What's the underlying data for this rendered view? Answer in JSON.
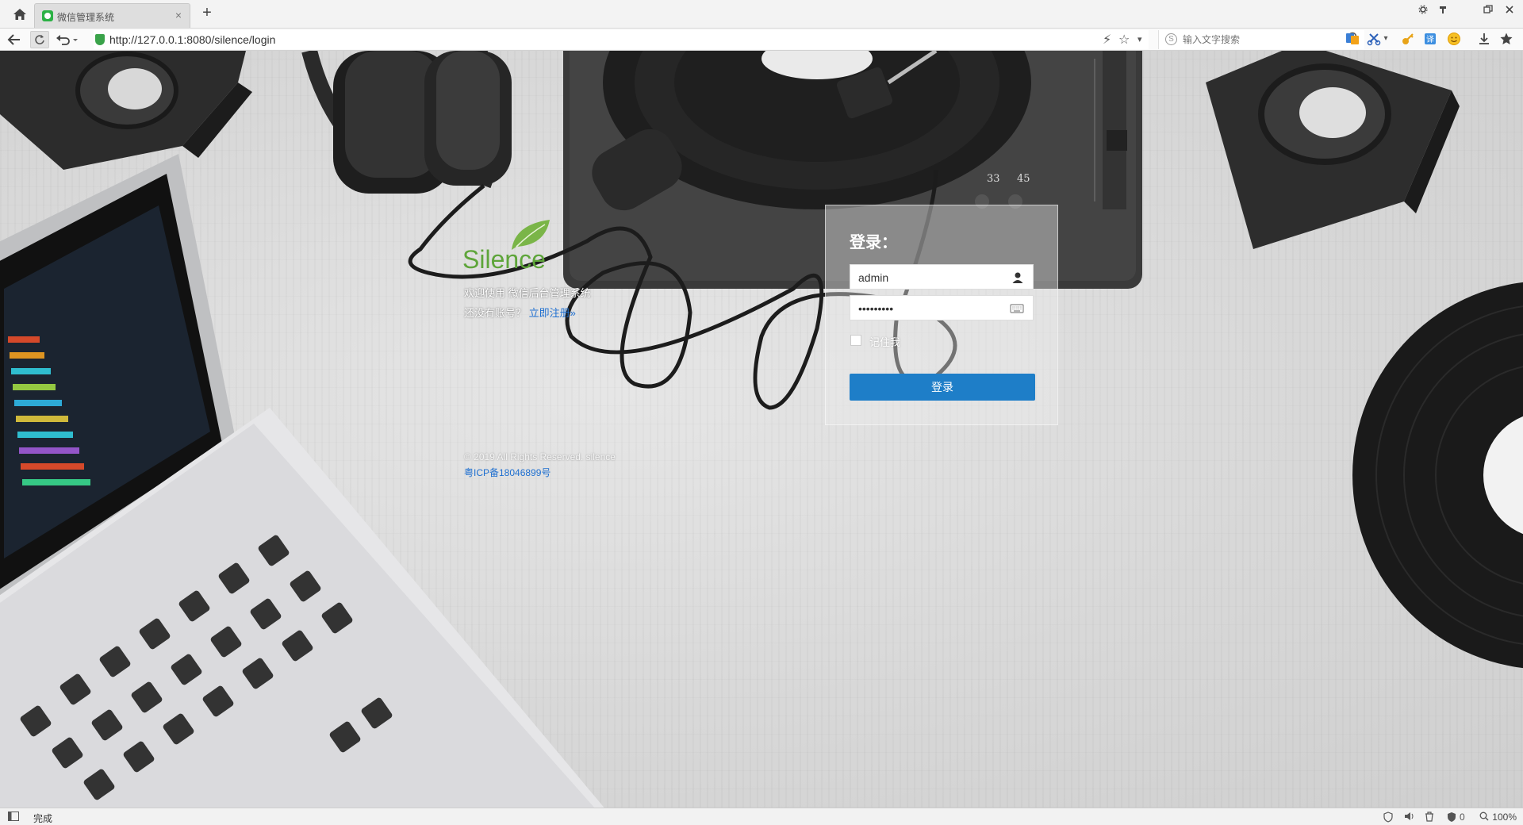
{
  "browser": {
    "tab_title": "微信管理系统",
    "tab_close": "×",
    "new_tab": "+",
    "url": "http://127.0.0.1:8080/silence/login",
    "search_placeholder": "输入文字搜索",
    "window_controls": [
      "settings-icon",
      "pin-icon",
      "restore-icon",
      "close-icon"
    ],
    "nav_icons": [
      "back-arrow-icon",
      "refresh-icon",
      "undo-icon"
    ],
    "toolbar_icons": [
      "speed-dial-icon",
      "translate-icon",
      "scissors-icon",
      "translate-badge-icon",
      "key-icon",
      "emoji-icon",
      "download-icon",
      "favorites-star-icon"
    ]
  },
  "page": {
    "logo_text": "Silence",
    "welcome": "欢迎使用 微信后台管理系统",
    "no_account": "还没有账号？",
    "register_link": "立即注册»",
    "copyright": "© 2019 All Rights Reserved. silence",
    "icp": "粤ICP备18046899号"
  },
  "login": {
    "title": "登录：",
    "username_value": "admin",
    "password_value": "•••••••••",
    "remember_label": "记住我",
    "remember_checked": false,
    "submit_label": "登录"
  },
  "decor": {
    "turntable_speed_labels": [
      "33",
      "45"
    ]
  },
  "statusbar": {
    "status": "完成",
    "zoom": "100%",
    "badge_count": "0"
  },
  "colors": {
    "primary_button": "#1e7ec8",
    "link": "#1e6fd0",
    "logo_green": "#5ea53a",
    "secure_green": "#3aa34a"
  }
}
